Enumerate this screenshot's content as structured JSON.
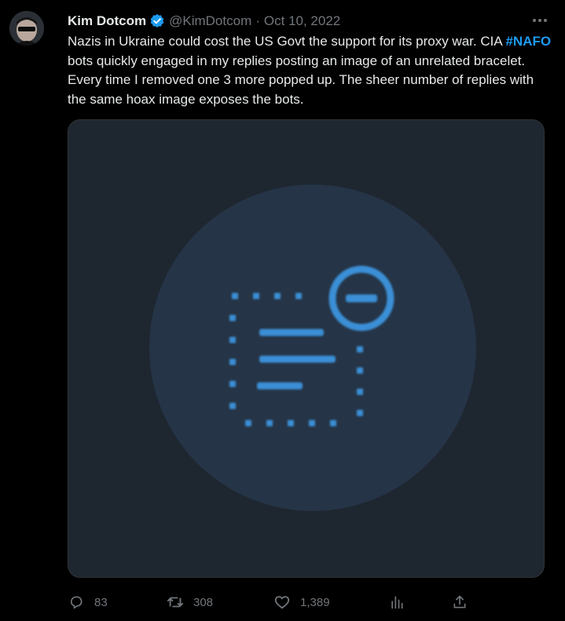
{
  "tweet": {
    "author_name": "Kim Dotcom",
    "handle": "@KimDotcom",
    "separator": "·",
    "date": "Oct 10, 2022",
    "text_before": "Nazis in Ukraine could cost the US Govt the support for its proxy war. CIA ",
    "hashtag": "#NAFO",
    "text_after": " bots quickly engaged in my replies posting an image of an unrelated bracelet. Every time I removed one 3 more popped up. The sheer number of replies with the same hoax image exposes the bots."
  },
  "icons": {
    "more": "more-options-icon",
    "verified": "verified-badge-icon",
    "media_placeholder": "media-removed-icon",
    "reply": "reply-icon",
    "retweet": "retweet-icon",
    "like": "like-icon",
    "views": "views-icon",
    "share": "share-icon"
  },
  "actions": {
    "replies": "83",
    "retweets": "308",
    "likes": "1,389"
  },
  "colors": {
    "background": "#000000",
    "accent": "#1d9bf0",
    "muted": "#71767b",
    "media_bg": "#1e2630"
  }
}
